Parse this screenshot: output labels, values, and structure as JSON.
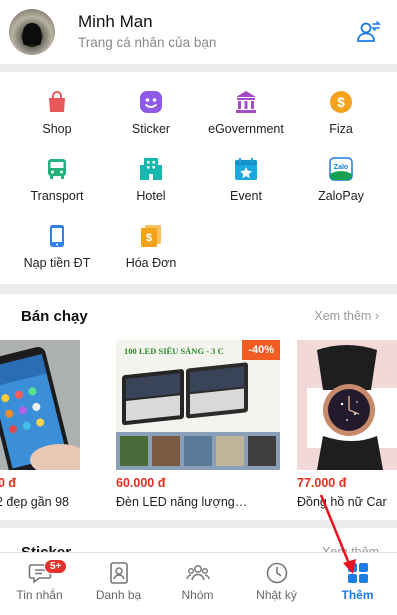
{
  "profile": {
    "name": "Minh Man",
    "subtitle": "Trang cá nhân của bạn",
    "switch_icon": "switch-account-icon"
  },
  "utilities": [
    {
      "label": "Shop",
      "icon": "shop-bag-icon",
      "color": "#e8585b"
    },
    {
      "label": "Sticker",
      "icon": "sticker-icon",
      "color": "#8e5ae6"
    },
    {
      "label": "eGovernment",
      "icon": "government-building-icon",
      "color": "#a24dc5"
    },
    {
      "label": "Fiza",
      "icon": "coin-icon",
      "color": "#f4a11c"
    },
    {
      "label": "Transport",
      "icon": "bus-icon",
      "color": "#22b07d"
    },
    {
      "label": "Hotel",
      "icon": "hotel-icon",
      "color": "#17b7b0"
    },
    {
      "label": "Event",
      "icon": "calendar-star-icon",
      "color": "#19a8e0"
    },
    {
      "label": "ZaloPay",
      "icon": "zalopay-icon",
      "color": "#16a052"
    },
    {
      "label": "Nạp tiền ĐT",
      "icon": "phone-topup-icon",
      "color": "#2f80ed"
    },
    {
      "label": "Hóa Đơn",
      "icon": "bill-icon",
      "color": "#f4a11c"
    }
  ],
  "best_selling": {
    "title": "Bán chạy",
    "see_more": "Xem thêm",
    "products": [
      {
        "price": "0 đ",
        "name": "2 đẹp gần 98",
        "image": "smartphone-image"
      },
      {
        "price": "60.000 đ",
        "name": "Đèn LED năng lượng…",
        "image": "solar-led-lamp-image",
        "banner": "100 LED SIÊU SÁNG - 3 C",
        "discount": "-40%"
      },
      {
        "price": "77.000 đ",
        "name": "Đồng hồ nữ Car",
        "image": "women-watch-image"
      }
    ]
  },
  "sticker_section": {
    "title": "Sticker",
    "see_more": "Xem thêm"
  },
  "tabbar": {
    "tabs": [
      {
        "label": "Tin nhắn",
        "icon": "chat-bubble-icon",
        "badge": "5+"
      },
      {
        "label": "Danh bạ",
        "icon": "contacts-icon"
      },
      {
        "label": "Nhóm",
        "icon": "group-icon"
      },
      {
        "label": "Nhật ký",
        "icon": "clock-icon"
      },
      {
        "label": "Thêm",
        "icon": "grid-more-icon",
        "active": true
      }
    ]
  },
  "colors": {
    "accent": "#1b7ce4",
    "price": "#e0301e",
    "badge": "#e5322e",
    "annotation_arrow": "#e8131d"
  }
}
